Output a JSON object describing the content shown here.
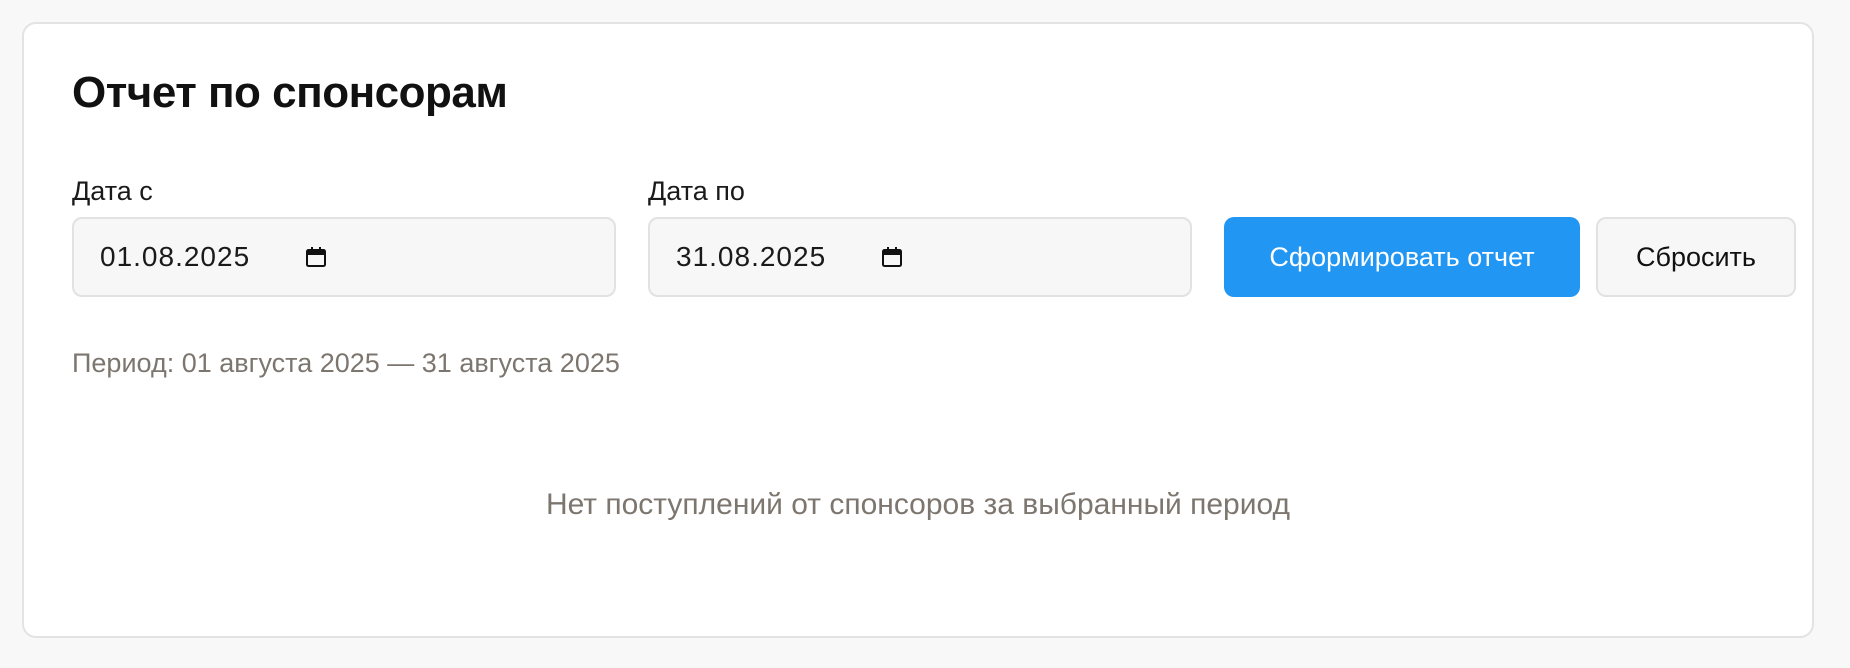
{
  "report": {
    "title": "Отчет по спонсорам",
    "date_from": {
      "label": "Дата с",
      "value": "01.08.2025",
      "icon": "calendar-icon"
    },
    "date_to": {
      "label": "Дата по",
      "value": "31.08.2025",
      "icon": "calendar-icon"
    },
    "generate_label": "Сформировать отчет",
    "reset_label": "Сбросить",
    "period_text": "Период: 01 августа 2025 — 31 августа 2025",
    "empty_message": "Нет поступлений от спонсоров за выбранный период"
  },
  "colors": {
    "primary": "#2196f3",
    "muted_text": "#7d766f",
    "field_bg": "#f7f7f7",
    "border": "#e2e2e2"
  }
}
